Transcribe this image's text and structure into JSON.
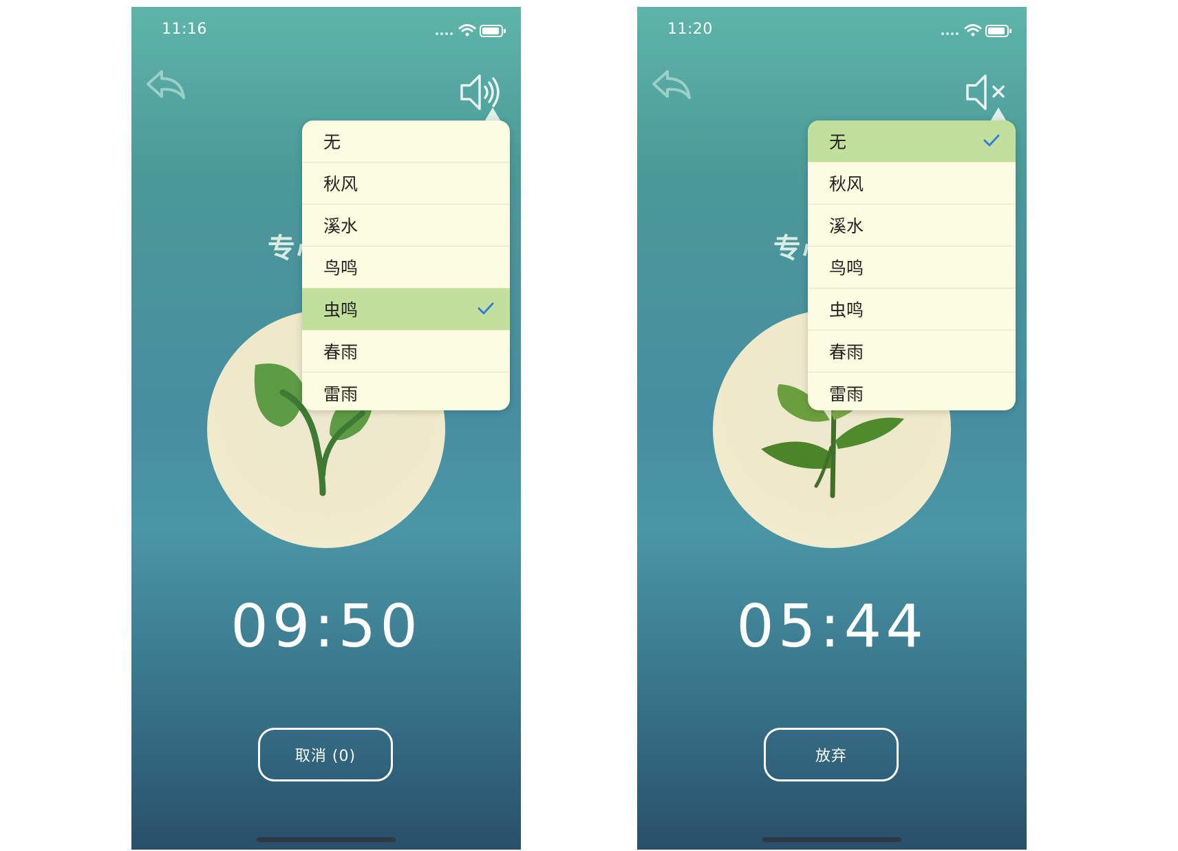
{
  "colors": {
    "bg_top": "#5eb5a9",
    "bg_bottom": "#294f6a",
    "menu_bg": "#fcfce0",
    "menu_selected": "#c2e09c",
    "check": "#2f7de1",
    "circle": "#efe9c9",
    "leaf": "#5e9b45",
    "stem": "#3f7a35"
  },
  "screens": [
    {
      "status_time": "11:16",
      "back_icon": "reply-arrow-icon",
      "sound_icon": "speaker-on-icon",
      "focus_title": "专心",
      "sound_menu": {
        "items": [
          "无",
          "秋风",
          "溪水",
          "鸟鸣",
          "虫鸣",
          "春雨",
          "雷雨"
        ],
        "selected": "虫鸣"
      },
      "plant_icon": "seedling-icon",
      "timer": "09:50",
      "action_button": "取消 (0)"
    },
    {
      "status_time": "11:20",
      "back_icon": "reply-arrow-icon",
      "sound_icon": "speaker-muted-icon",
      "focus_title": "专心",
      "sound_menu": {
        "items": [
          "无",
          "秋风",
          "溪水",
          "鸟鸣",
          "虫鸣",
          "春雨",
          "雷雨"
        ],
        "selected": "无"
      },
      "plant_icon": "tea-sprout-icon",
      "timer": "05:44",
      "action_button": "放弃"
    }
  ]
}
